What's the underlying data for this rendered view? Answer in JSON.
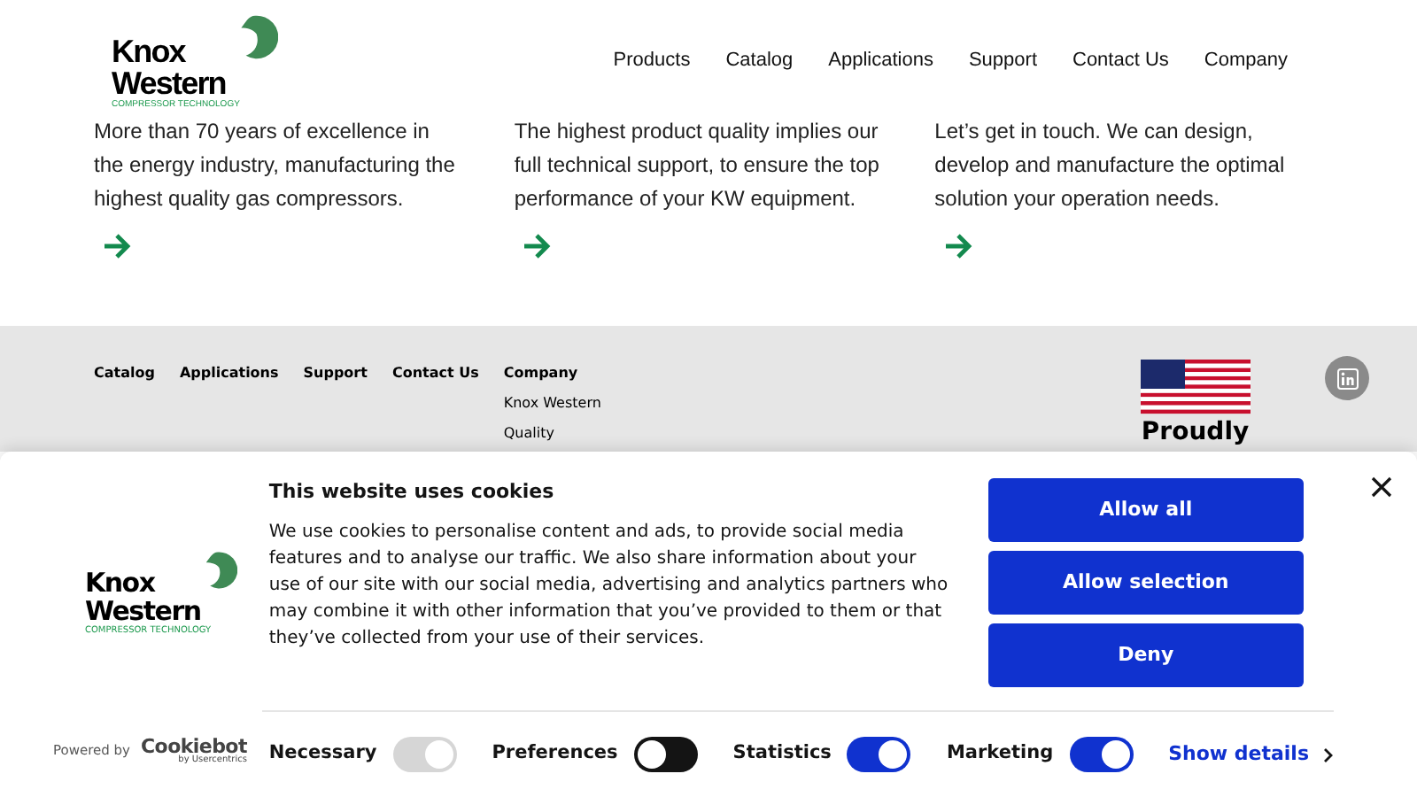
{
  "header": {
    "logo": {
      "name": "Knox Western",
      "tagline": "COMPRESSOR TECHNOLOGY"
    },
    "nav": [
      "Products",
      "Catalog",
      "Applications",
      "Support",
      "Contact Us",
      "Company"
    ]
  },
  "features": [
    {
      "text": "More than 70 years of excellence in the energy industry, manufacturing the highest quality gas compressors."
    },
    {
      "text": "The highest product quality implies our full technical support, to ensure the top performance of your KW equipment."
    },
    {
      "text": "Let’s get in touch. We can design, develop and manufacture the optimal solution your operation needs."
    }
  ],
  "footer": {
    "links": [
      {
        "label": "Catalog"
      },
      {
        "label": "Applications"
      },
      {
        "label": "Support"
      },
      {
        "label": "Contact Us"
      },
      {
        "label": "Company",
        "children": [
          "Knox Western",
          "Quality"
        ]
      }
    ],
    "badge": "Proudly"
  },
  "cookie_banner": {
    "logo": {
      "name": "Knox Western",
      "tagline": "COMPRESSOR TECHNOLOGY"
    },
    "title": "This website uses cookies",
    "body": "We use cookies to personalise content and ads, to provide social media features and to analyse our traffic. We also share information about your use of our site with our social media, advertising and analytics partners who may combine it with other information that you’ve provided to them or that they’ve collected from your use of their services.",
    "buttons": [
      "Allow all",
      "Allow selection",
      "Deny"
    ],
    "powered_by": "Powered by",
    "brand": "Cookiebot",
    "brand_sub": "by Usercentrics",
    "toggles": [
      {
        "label": "Necessary",
        "on": true,
        "disabled": true
      },
      {
        "label": "Preferences",
        "on": false,
        "disabled": false
      },
      {
        "label": "Statistics",
        "on": true,
        "disabled": false
      },
      {
        "label": "Marketing",
        "on": true,
        "disabled": false
      }
    ],
    "show_details": "Show details"
  }
}
